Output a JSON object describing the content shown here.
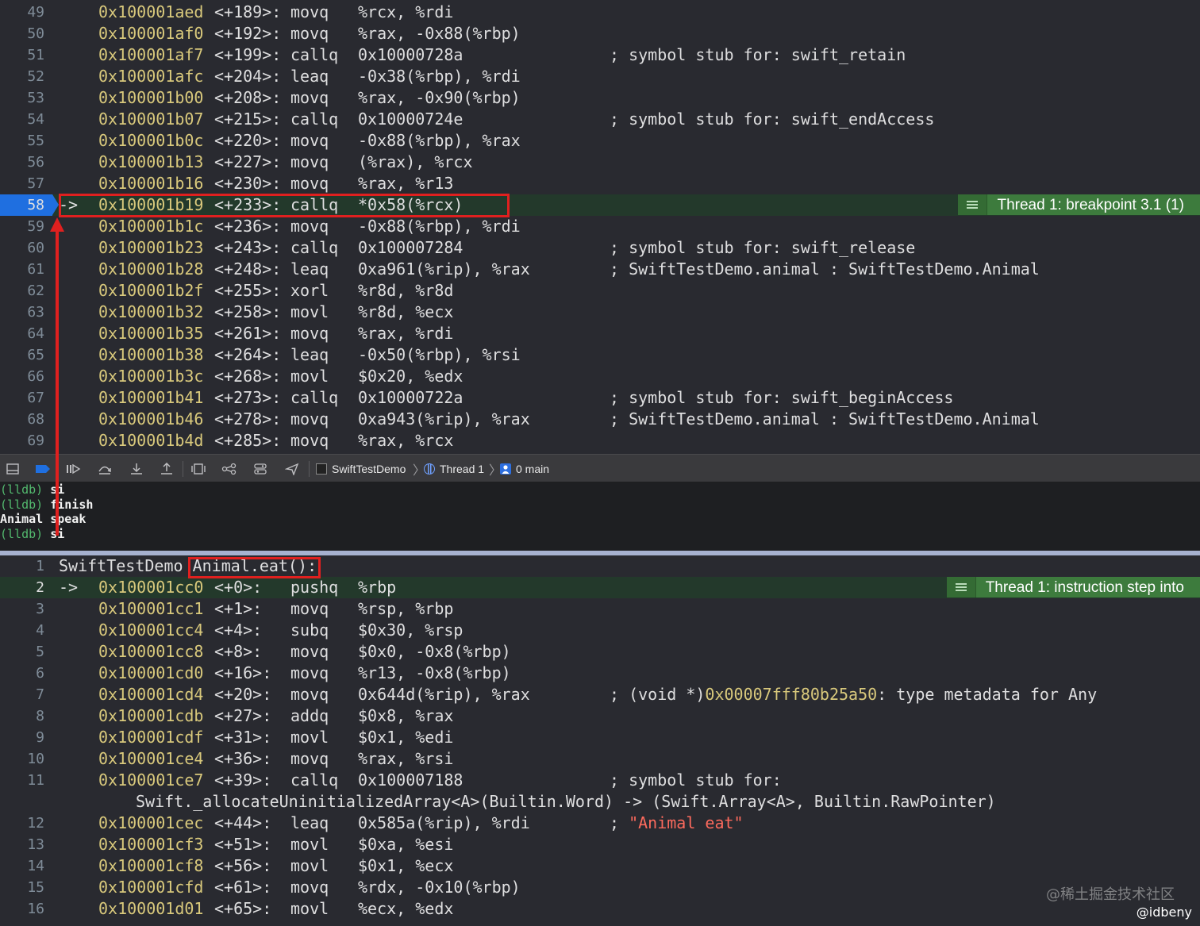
{
  "top_disasm": [
    {
      "ln": "49",
      "addr": "0x100001aed",
      "off": "<+189>:",
      "mn": "movq",
      "ops": "%rcx, %rdi",
      "cmt": ""
    },
    {
      "ln": "50",
      "addr": "0x100001af0",
      "off": "<+192>:",
      "mn": "movq",
      "ops": "%rax, -0x88(%rbp)",
      "cmt": ""
    },
    {
      "ln": "51",
      "addr": "0x100001af7",
      "off": "<+199>:",
      "mn": "callq",
      "ops": "0x10000728a",
      "cmt": "; symbol stub for: swift_retain"
    },
    {
      "ln": "52",
      "addr": "0x100001afc",
      "off": "<+204>:",
      "mn": "leaq",
      "ops": "-0x38(%rbp), %rdi",
      "cmt": ""
    },
    {
      "ln": "53",
      "addr": "0x100001b00",
      "off": "<+208>:",
      "mn": "movq",
      "ops": "%rax, -0x90(%rbp)",
      "cmt": ""
    },
    {
      "ln": "54",
      "addr": "0x100001b07",
      "off": "<+215>:",
      "mn": "callq",
      "ops": "0x10000724e",
      "cmt": "; symbol stub for: swift_endAccess"
    },
    {
      "ln": "55",
      "addr": "0x100001b0c",
      "off": "<+220>:",
      "mn": "movq",
      "ops": "-0x88(%rbp), %rax",
      "cmt": ""
    },
    {
      "ln": "56",
      "addr": "0x100001b13",
      "off": "<+227>:",
      "mn": "movq",
      "ops": "(%rax), %rcx",
      "cmt": ""
    },
    {
      "ln": "57",
      "addr": "0x100001b16",
      "off": "<+230>:",
      "mn": "movq",
      "ops": "%rax, %r13",
      "cmt": ""
    },
    {
      "ln": "58",
      "arrow": "->",
      "addr": "0x100001b19",
      "off": "<+233>:",
      "mn": "callq",
      "ops": "*0x58(%rcx)",
      "cmt": "",
      "hl": true,
      "badge": "Thread 1: breakpoint 3.1 (1)"
    },
    {
      "ln": "59",
      "addr": "0x100001b1c",
      "off": "<+236>:",
      "mn": "movq",
      "ops": "-0x88(%rbp), %rdi",
      "cmt": ""
    },
    {
      "ln": "60",
      "addr": "0x100001b23",
      "off": "<+243>:",
      "mn": "callq",
      "ops": "0x100007284",
      "cmt": "; symbol stub for: swift_release"
    },
    {
      "ln": "61",
      "addr": "0x100001b28",
      "off": "<+248>:",
      "mn": "leaq",
      "ops": "0xa961(%rip), %rax",
      "cmt": "; SwiftTestDemo.animal : SwiftTestDemo.Animal"
    },
    {
      "ln": "62",
      "addr": "0x100001b2f",
      "off": "<+255>:",
      "mn": "xorl",
      "ops": "%r8d, %r8d",
      "cmt": ""
    },
    {
      "ln": "63",
      "addr": "0x100001b32",
      "off": "<+258>:",
      "mn": "movl",
      "ops": "%r8d, %ecx",
      "cmt": ""
    },
    {
      "ln": "64",
      "addr": "0x100001b35",
      "off": "<+261>:",
      "mn": "movq",
      "ops": "%rax, %rdi",
      "cmt": ""
    },
    {
      "ln": "65",
      "addr": "0x100001b38",
      "off": "<+264>:",
      "mn": "leaq",
      "ops": "-0x50(%rbp), %rsi",
      "cmt": ""
    },
    {
      "ln": "66",
      "addr": "0x100001b3c",
      "off": "<+268>:",
      "mn": "movl",
      "ops": "$0x20, %edx",
      "cmt": ""
    },
    {
      "ln": "67",
      "addr": "0x100001b41",
      "off": "<+273>:",
      "mn": "callq",
      "ops": "0x10000722a",
      "cmt": "; symbol stub for: swift_beginAccess"
    },
    {
      "ln": "68",
      "addr": "0x100001b46",
      "off": "<+278>:",
      "mn": "movq",
      "ops": "0xa943(%rip), %rax",
      "cmt": "; SwiftTestDemo.animal : SwiftTestDemo.Animal"
    },
    {
      "ln": "69",
      "addr": "0x100001b4d",
      "off": "<+285>:",
      "mn": "movq",
      "ops": "%rax, %rcx",
      "cmt": ""
    }
  ],
  "toolbar": {
    "crumbs": [
      "SwiftTestDemo",
      "Thread 1",
      "0 main"
    ],
    "icons": [
      "hide-panel-icon",
      "breakpoint-toggle-icon",
      "continue-icon",
      "step-over-icon",
      "step-into-icon",
      "step-out-icon",
      "view-hierarchy-icon",
      "memory-graph-icon",
      "environment-icon",
      "location-icon"
    ]
  },
  "console": [
    {
      "prompt": "(lldb)",
      "cmd": "si"
    },
    {
      "prompt": "(lldb)",
      "cmd": "finish"
    },
    {
      "prompt": "",
      "cmd": "Animal speak"
    },
    {
      "prompt": "(lldb)",
      "cmd": "si"
    }
  ],
  "bottom_header": {
    "ln": "1",
    "module": "SwiftTestDemo",
    "func": "Animal.eat():"
  },
  "bottom_disasm": [
    {
      "ln": "2",
      "arrow": "->",
      "addr": "0x100001cc0",
      "off": "<+0>:",
      "mn": "pushq",
      "ops": "%rbp",
      "cmt": "",
      "hl": true,
      "badge": "Thread 1: instruction step into"
    },
    {
      "ln": "3",
      "addr": "0x100001cc1",
      "off": "<+1>:",
      "mn": "movq",
      "ops": "%rsp, %rbp",
      "cmt": ""
    },
    {
      "ln": "4",
      "addr": "0x100001cc4",
      "off": "<+4>:",
      "mn": "subq",
      "ops": "$0x30, %rsp",
      "cmt": ""
    },
    {
      "ln": "5",
      "addr": "0x100001cc8",
      "off": "<+8>:",
      "mn": "movq",
      "ops": "$0x0, -0x8(%rbp)",
      "cmt": ""
    },
    {
      "ln": "6",
      "addr": "0x100001cd0",
      "off": "<+16>:",
      "mn": "movq",
      "ops": "%r13, -0x8(%rbp)",
      "cmt": ""
    },
    {
      "ln": "7",
      "addr": "0x100001cd4",
      "off": "<+20>:",
      "mn": "movq",
      "ops": "0x644d(%rip), %rax",
      "cmt": "; (void *)",
      "cmt_hex": "0x00007fff80b25a50",
      "cmt_tail": ": type metadata for Any"
    },
    {
      "ln": "8",
      "addr": "0x100001cdb",
      "off": "<+27>:",
      "mn": "addq",
      "ops": "$0x8, %rax",
      "cmt": ""
    },
    {
      "ln": "9",
      "addr": "0x100001cdf",
      "off": "<+31>:",
      "mn": "movl",
      "ops": "$0x1, %edi",
      "cmt": ""
    },
    {
      "ln": "10",
      "addr": "0x100001ce4",
      "off": "<+36>:",
      "mn": "movq",
      "ops": "%rax, %rsi",
      "cmt": ""
    },
    {
      "ln": "11",
      "addr": "0x100001ce7",
      "off": "<+39>:",
      "mn": "callq",
      "ops": "0x100007188",
      "cmt": "; symbol stub for:"
    },
    {
      "cont": "Swift._allocateUninitializedArray<A>(Builtin.Word) -> (Swift.Array<A>, Builtin.RawPointer)"
    },
    {
      "ln": "12",
      "addr": "0x100001cec",
      "off": "<+44>:",
      "mn": "leaq",
      "ops": "0x585a(%rip), %rdi",
      "cmt": "; ",
      "cmt_str": "\"Animal eat\""
    },
    {
      "ln": "13",
      "addr": "0x100001cf3",
      "off": "<+51>:",
      "mn": "movl",
      "ops": "$0xa, %esi",
      "cmt": ""
    },
    {
      "ln": "14",
      "addr": "0x100001cf8",
      "off": "<+56>:",
      "mn": "movl",
      "ops": "$0x1, %ecx",
      "cmt": ""
    },
    {
      "ln": "15",
      "addr": "0x100001cfd",
      "off": "<+61>:",
      "mn": "movq",
      "ops": "%rdx, -0x10(%rbp)",
      "cmt": ""
    },
    {
      "ln": "16",
      "addr": "0x100001d01",
      "off": "<+65>:",
      "mn": "movl",
      "ops": "%ecx, %edx",
      "cmt": ""
    }
  ],
  "watermark": "@稀土掘金技术社区",
  "author": "@idbeny",
  "colors": {
    "address": "#d9c97c",
    "highlight_row": "#23392b",
    "badge": "#3d7b3d",
    "pc_marker": "#1f6fe0",
    "annotation": "#e0201f",
    "string": "#fc6a5d",
    "prompt": "#53b96e"
  }
}
